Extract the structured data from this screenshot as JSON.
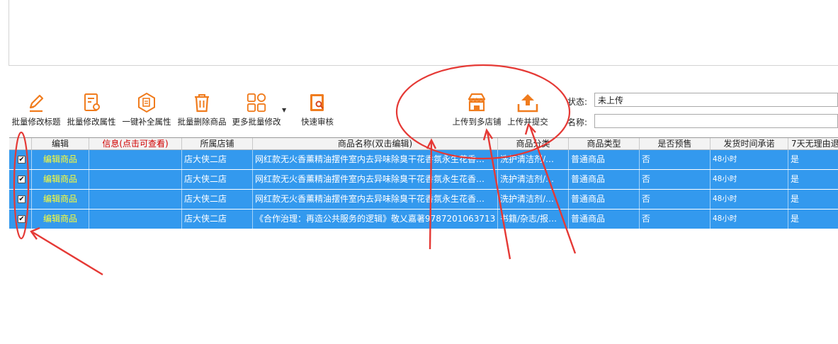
{
  "toolbar": {
    "batch_edit_title": "批量修改标题",
    "batch_edit_attr": "批量修改属性",
    "one_click_fill": "一键补全属性",
    "batch_delete": "批量删除商品",
    "more_batch_edit": "更多批量修改",
    "quick_review": "快速审核",
    "upload_multi_store": "上传到多店铺",
    "upload_submit": "上传并提交"
  },
  "filters": {
    "status_label": "状态:",
    "status_value": "未上传",
    "name_label": "名称:",
    "name_value": ""
  },
  "table": {
    "headers": [
      "编辑",
      "信息(点击可查看)",
      "所属店铺",
      "商品名称(双击编辑)",
      "商品分类",
      "商品类型",
      "是否预售",
      "发货时间承诺",
      "7天无理由退"
    ],
    "rows": [
      {
        "checked": "✔",
        "edit": "编辑商品",
        "info": "",
        "store": "店大侠二店",
        "name": "网红款无火香薰精油摆件室内去异味除臭干花香氛永生花香…",
        "category": "洗护清洁剂/…",
        "type": "普通商品",
        "presale": "否",
        "ship": "48小时",
        "return7": "是"
      },
      {
        "checked": "✔",
        "edit": "编辑商品",
        "info": "",
        "store": "店大侠二店",
        "name": "网红款无火香薰精油摆件室内去异味除臭干花香氛永生花香…",
        "category": "洗护清洁剂/…",
        "type": "普通商品",
        "presale": "否",
        "ship": "48小时",
        "return7": "是"
      },
      {
        "checked": "✔",
        "edit": "编辑商品",
        "info": "",
        "store": "店大侠二店",
        "name": "网红款无火香薰精油摆件室内去异味除臭干花香氛永生花香…",
        "category": "洗护清洁剂/…",
        "type": "普通商品",
        "presale": "否",
        "ship": "48小时",
        "return7": "是"
      },
      {
        "checked": "✔",
        "edit": "编辑商品",
        "info": "",
        "store": "店大侠二店",
        "name": "《合作治理：再造公共服务的逻辑》敬乂嘉著9787201063713",
        "category": "书籍/杂志/报…",
        "type": "普通商品",
        "presale": "否",
        "ship": "48小时",
        "return7": "是"
      }
    ]
  },
  "colors": {
    "accent_orange": "#f07c1e",
    "row_selected": "#3399ee",
    "annotation_red": "#e53935",
    "edit_link": "#ffff33"
  }
}
